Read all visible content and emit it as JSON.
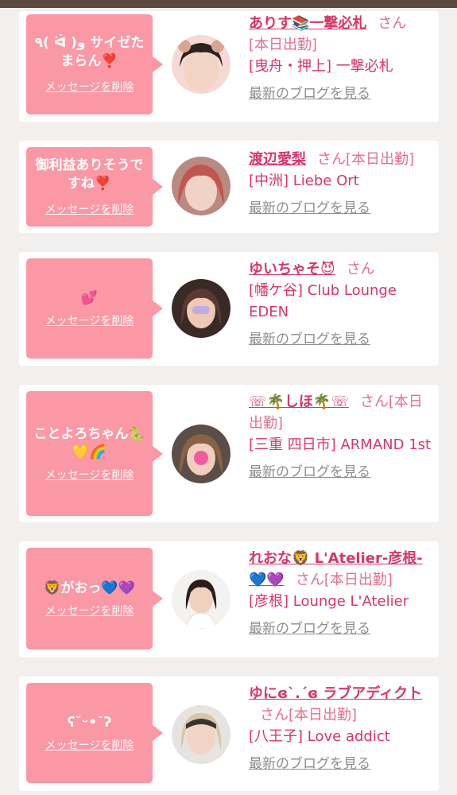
{
  "cards": [
    {
      "message": "٩( ᐛ )و サイゼたまらん❣️",
      "delete_label": "メッセージを削除",
      "name": "ありす📚一撃必札",
      "san": "さん",
      "status": "[本日出勤]",
      "shop": "[曳舟・押上] 一撃必札",
      "blog": "最新のブログを見る"
    },
    {
      "message": "御利益ありそうですね❣️",
      "delete_label": "メッセージを削除",
      "name": "渡辺愛梨",
      "san": "さん",
      "status": "[本日出勤]",
      "shop": "[中洲] Liebe Ort",
      "blog": "最新のブログを見る"
    },
    {
      "message": "💕",
      "delete_label": "メッセージを削除",
      "name": "ゆいちゃそ😈",
      "san": "さん",
      "status": "",
      "shop": "[幡ケ谷] Club Lounge EDEN",
      "blog": "最新のブログを見る"
    },
    {
      "message": "ことよろちゃん🐍💛🌈",
      "delete_label": "メッセージを削除",
      "name": "☏🌴しほ🌴☏",
      "san": "さん",
      "status": "[本日出勤]",
      "shop": "[三重 四日市] ARMAND 1st",
      "blog": "最新のブログを見る"
    },
    {
      "message": "🦁がおっ💙💜",
      "delete_label": "メッセージを削除",
      "name": "れおな🦁 L'Atelier-彦根-💙💜",
      "san": "さん",
      "status": "[本日出勤]",
      "shop": "[彦根] Lounge L'Atelier",
      "blog": "最新のブログを見る"
    },
    {
      "message": "ʕ˘ᵕ•˘ʔ",
      "delete_label": "メッセージを削除",
      "name": "ゆにɞ`.´ɞ ラブアディクト",
      "san": "さん",
      "status": "[本日出勤]",
      "shop": "[八王子] Love addict",
      "blog": "最新のブログを見る"
    }
  ]
}
